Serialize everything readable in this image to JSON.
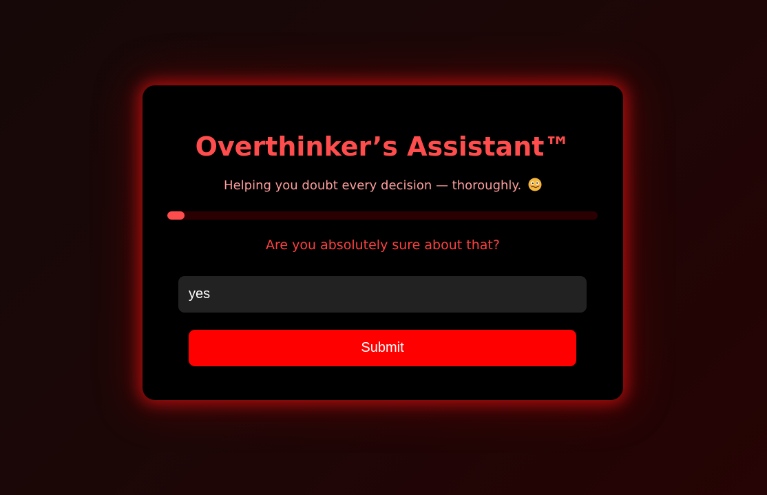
{
  "app": {
    "title": "Overthinker’s Assistant™",
    "subtitle": "Helping you doubt every decision — thoroughly.",
    "subtitle_icon": "woozy-face-emoji"
  },
  "progress": {
    "fraction": 0.04
  },
  "question": {
    "text": "Are you absolutely sure about that?"
  },
  "answer": {
    "value": "yes"
  },
  "submit": {
    "label": "Submit"
  },
  "colors": {
    "accent": "#ff4d4d",
    "button": "#ff0000",
    "card": "#000000",
    "input": "#222222",
    "track": "#2a0003"
  }
}
